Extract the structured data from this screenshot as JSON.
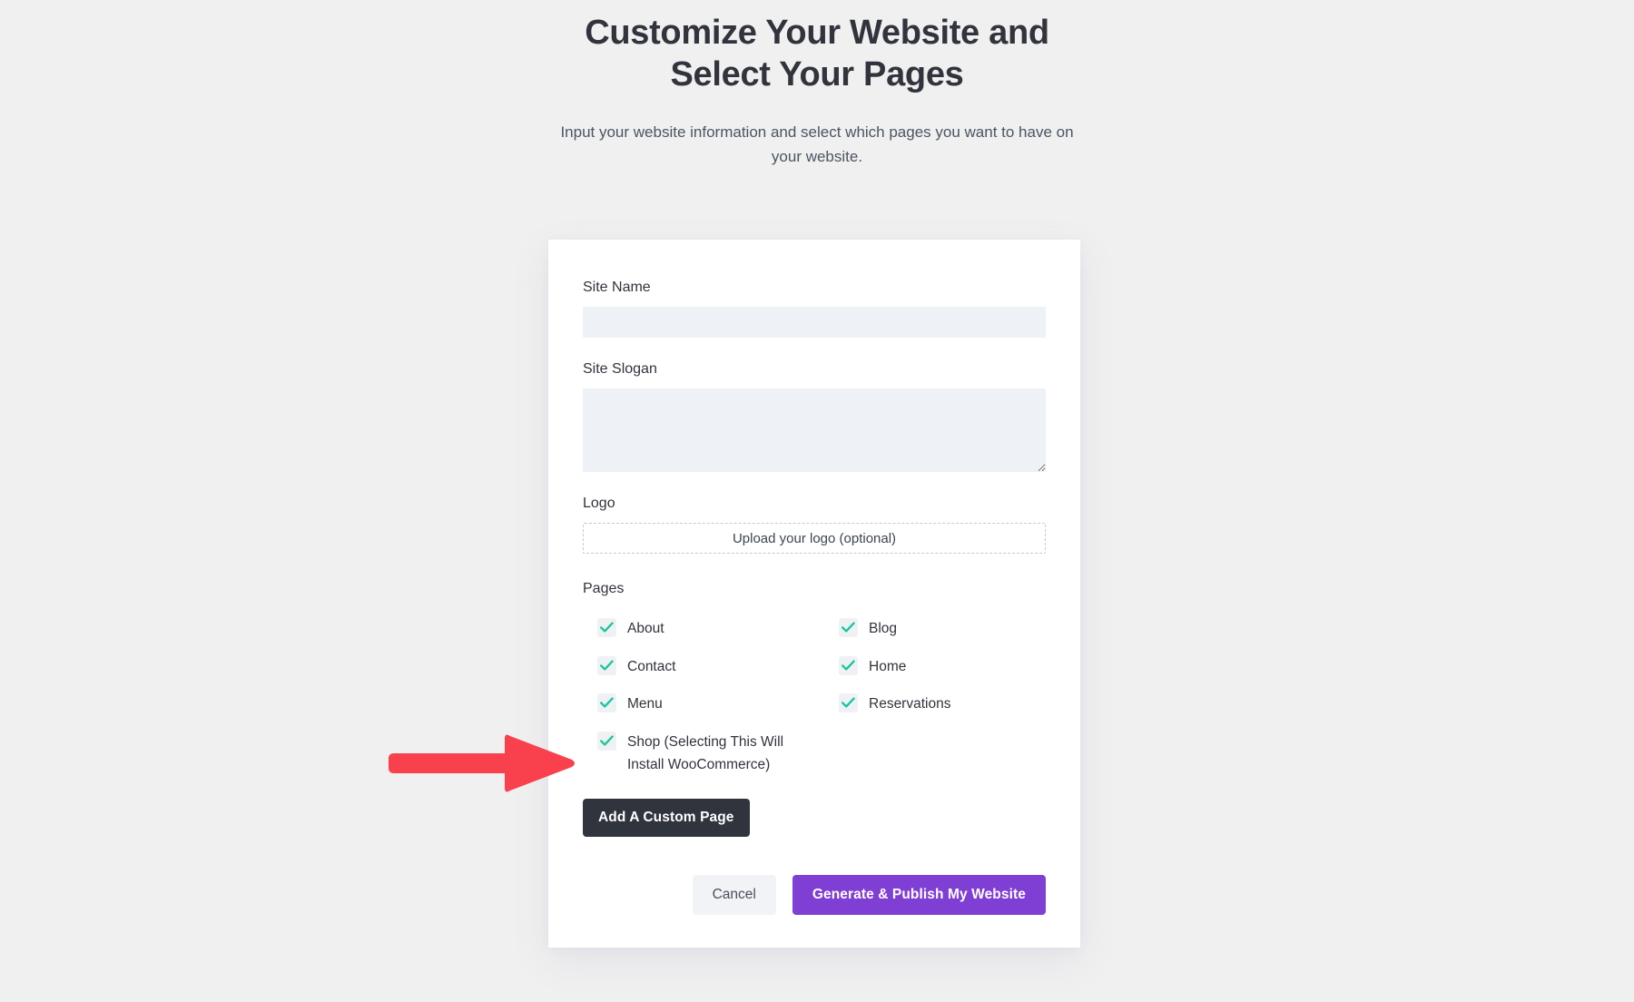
{
  "header": {
    "title": "Customize Your Website and Select Your Pages",
    "subtitle": "Input your website information and select which pages you want to have on your website."
  },
  "form": {
    "site_name": {
      "label": "Site Name",
      "value": "",
      "placeholder": ""
    },
    "site_slogan": {
      "label": "Site Slogan",
      "value": "",
      "placeholder": ""
    },
    "logo": {
      "label": "Logo",
      "upload_text": "Upload your logo (optional)"
    },
    "pages": {
      "label": "Pages",
      "items": [
        {
          "label": "About",
          "checked": true
        },
        {
          "label": "Blog",
          "checked": true
        },
        {
          "label": "Contact",
          "checked": true
        },
        {
          "label": "Home",
          "checked": true
        },
        {
          "label": "Menu",
          "checked": true
        },
        {
          "label": "Reservations",
          "checked": true
        },
        {
          "label": "Shop (Selecting This Will Install WooCommerce)",
          "checked": true
        }
      ]
    },
    "add_custom_page_label": "Add A Custom Page"
  },
  "actions": {
    "cancel_label": "Cancel",
    "publish_label": "Generate & Publish My Website"
  },
  "annotation": {
    "arrow": "right-arrow",
    "color": "#f9404d"
  },
  "colors": {
    "background": "#f0f0f0",
    "card": "#ffffff",
    "input_fill": "#eef2f6",
    "checkbox_fill": "#eff1f5",
    "check_green": "#16c79a",
    "dark_button": "#2f343d",
    "purple_button": "#7f3fd4",
    "cancel_button": "#f1f3f7",
    "text_primary": "#31343c",
    "text_secondary": "#4b5563",
    "arrow_red": "#f9404d"
  }
}
